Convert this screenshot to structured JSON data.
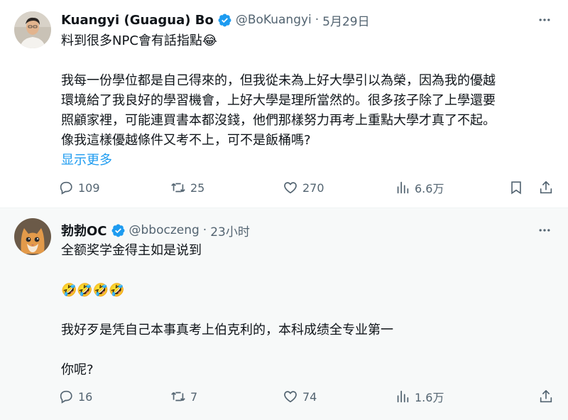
{
  "tweets": [
    {
      "name": "Kuangyi (Guagua) Bo",
      "handle": "@BoKuangyi",
      "separator": "·",
      "time": "5月29日",
      "lines": [
        "料到很多NPC會有話指點😂",
        "",
        "我每一份學位都是自己得來的，但我從未為上好大學引以為榮，因為我的優越",
        "環境給了我良好的學習機會，上好大學是理所當然的。很多孩子除了上學還要",
        "照顧家裡，可能連買書本都沒錢，他們那樣努力再考上重點大學才真了不起。",
        "像我這樣優越條件又考不上，可不是飯桶嗎?"
      ],
      "show_more": "显示更多",
      "replies": "109",
      "retweets": "25",
      "likes": "270",
      "views": "6.6万"
    },
    {
      "name": "勃勃OC",
      "handle": "@bboczeng",
      "separator": "·",
      "time": "23小时",
      "lines": [
        "全额奖学金得主如是说到",
        "",
        "🤣🤣🤣🤣",
        "",
        "我好歹是凭自己本事真考上伯克利的，本科成绩全专业第一",
        "",
        "你呢?"
      ],
      "replies": "16",
      "retweets": "7",
      "likes": "74",
      "views": "1.6万"
    }
  ],
  "colors": {
    "text": "#0f1419",
    "secondary": "#536471",
    "accent": "#1d9bf0",
    "reply_background": "#f7f9f9"
  },
  "icons": [
    "verified-badge-icon",
    "more-icon",
    "reply-icon",
    "retweet-icon",
    "like-icon",
    "views-icon",
    "bookmark-icon",
    "share-icon"
  ]
}
